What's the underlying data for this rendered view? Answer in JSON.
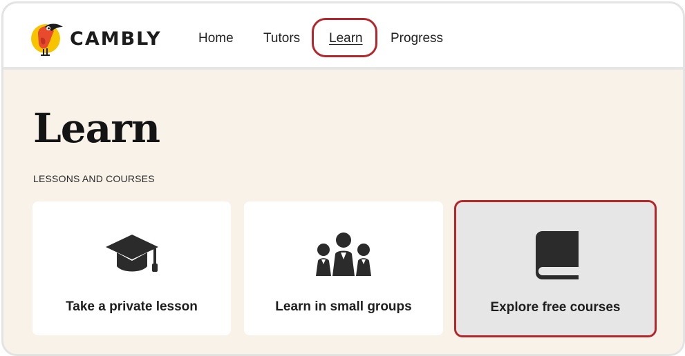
{
  "brand": {
    "name": "CAMBLY",
    "logo_icon": "toucan-logo-icon",
    "colors": {
      "logo_circle": "#f6c400",
      "logo_bird_red": "#e84a2e",
      "logo_bird_black": "#1c1c1c"
    }
  },
  "nav": {
    "items": [
      {
        "label": "Home",
        "active": false
      },
      {
        "label": "Tutors",
        "active": false
      },
      {
        "label": "Learn",
        "active": true
      },
      {
        "label": "Progress",
        "active": false
      }
    ]
  },
  "page": {
    "title": "Learn",
    "section_label": "LESSONS AND COURSES"
  },
  "cards": [
    {
      "label": "Take a private lesson",
      "icon": "graduation-cap-icon",
      "selected": false
    },
    {
      "label": "Learn in small groups",
      "icon": "group-people-icon",
      "selected": false
    },
    {
      "label": "Explore free courses",
      "icon": "book-icon",
      "selected": true
    }
  ],
  "colors": {
    "page_background": "#f9f2e8",
    "highlight_outline": "#b3262b",
    "selected_card_background": "#e6e6e6",
    "icon_color": "#2b2b2b"
  }
}
